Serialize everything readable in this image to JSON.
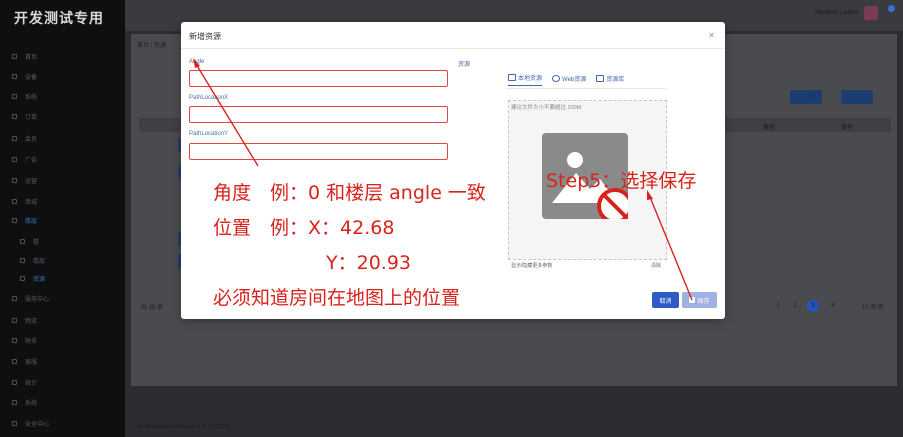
{
  "app": {
    "brand": "开发测试专用"
  },
  "topbar": {
    "user": "Manifest | admin"
  },
  "breadcrumb": "首页 / 资源",
  "sidebar": {
    "items": [
      {
        "label": "首页"
      },
      {
        "label": "设备"
      },
      {
        "label": "系统"
      },
      {
        "label": "订单"
      },
      {
        "label": "会员"
      },
      {
        "label": "广告"
      },
      {
        "label": "运营"
      },
      {
        "label": "商城"
      },
      {
        "label": "楼层"
      },
      {
        "label": "楼"
      },
      {
        "label": "楼层"
      },
      {
        "label": "资源"
      },
      {
        "label": "服务中心"
      },
      {
        "label": "物流"
      },
      {
        "label": "财务"
      },
      {
        "label": "客服"
      },
      {
        "label": "统计"
      },
      {
        "label": "系统"
      },
      {
        "label": "安全中心"
      }
    ]
  },
  "background": {
    "buttons": {
      "batch_delete": "批量删除",
      "add_resource": "添加资源"
    },
    "columns": {
      "col_a": "类型",
      "col_b": "操作"
    },
    "total": "共 38 条",
    "pages": [
      "1",
      "2",
      "3",
      "4"
    ],
    "page_size": "10 条/页",
    "footer": "SensingSaasCloudStandard v8.0.0 [2023]"
  },
  "modal": {
    "title": "新增资源",
    "fields": {
      "angle": {
        "label": "Angle",
        "value": ""
      },
      "x": {
        "label": "PathLocationX",
        "value": ""
      },
      "y": {
        "label": "PathLocationY",
        "value": ""
      }
    },
    "resource_label": "资源",
    "tabs": {
      "local": "本地资源",
      "web": "Web资源",
      "library": "资源库"
    },
    "upload_hint": "建议文件大小不要超过 200M",
    "more_options": "显示/隐藏更多参数",
    "clear": "清除",
    "cancel": "取消",
    "save": "保存"
  },
  "annotations": {
    "line1": "角度　例：0 和楼层 angle 一致",
    "line2": "位置　例：X：42.68",
    "line3": "Y：20.93",
    "line4": "必须知道房间在地图上的位置",
    "step5": "Step5：选择保存"
  },
  "colors": {
    "annotation": "#d8231d",
    "primary": "#2e5ac6",
    "field_error": "#e04848"
  }
}
